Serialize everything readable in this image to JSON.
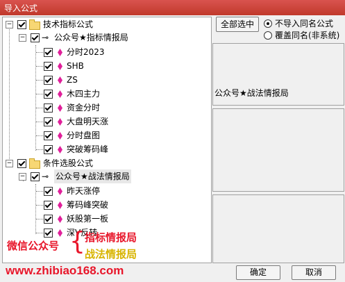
{
  "window": {
    "title": "导入公式"
  },
  "tree": {
    "groups": [
      {
        "label": "技术指标公式",
        "sub": {
          "label": "公众号★指标情报局",
          "items": [
            "分时2023",
            "SHB",
            "ZS",
            "木四主力",
            "资金分时",
            "大盘明天涨",
            "分时盘图",
            "突破筹码峰"
          ]
        }
      },
      {
        "label": "条件选股公式",
        "sub": {
          "label": "公众号★战法情报局",
          "items": [
            "昨天涨停",
            "筹码峰突破",
            "妖股第一板",
            "深V反转"
          ]
        }
      }
    ]
  },
  "right": {
    "select_all": "全部选中",
    "radio_skip": "不导入同名公式",
    "radio_overwrite": "覆盖同名(非系统)",
    "selected_name": "公众号★战法情报局"
  },
  "buttons": {
    "ok": "确定",
    "cancel": "取消"
  },
  "overlay": {
    "wechat": "微信公众号",
    "brace": "{",
    "line1": "指标情报局",
    "line2": "战法情报局",
    "url": "www.zhibiao168.com"
  }
}
